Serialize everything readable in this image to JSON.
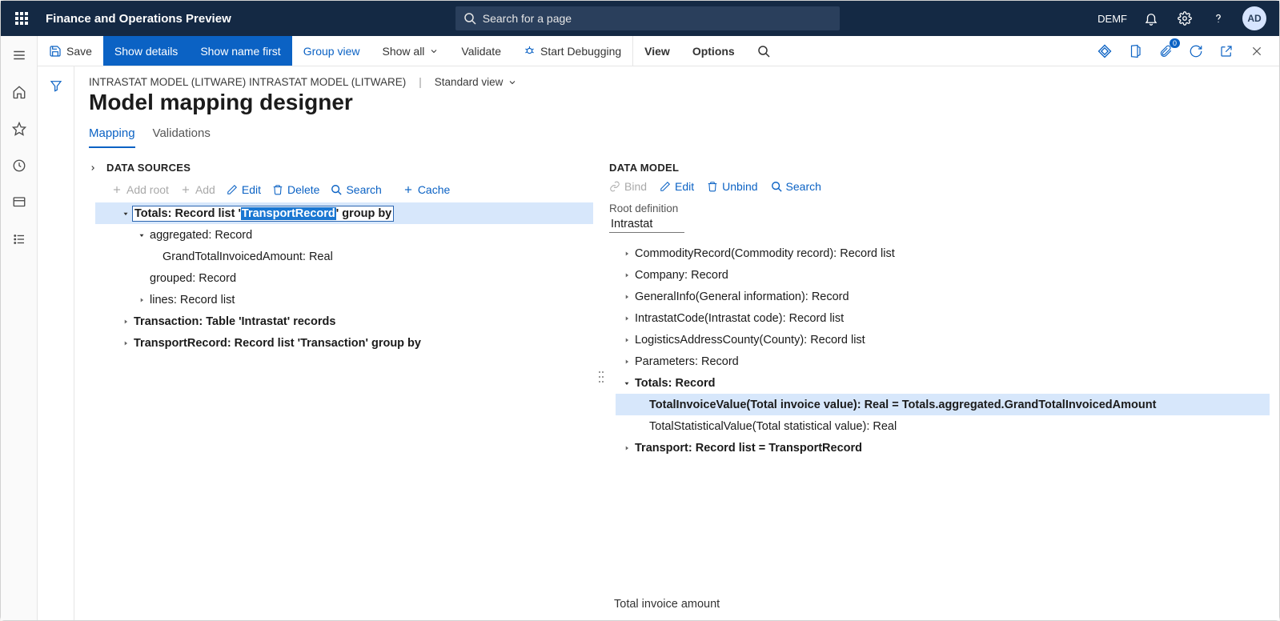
{
  "topbar": {
    "appTitle": "Finance and Operations Preview",
    "searchPlaceholder": "Search for a page",
    "companyCode": "DEMF",
    "avatarInitials": "AD"
  },
  "actionbar": {
    "save": "Save",
    "showDetails": "Show details",
    "showNameFirst": "Show name first",
    "groupView": "Group view",
    "showAll": "Show all",
    "validate": "Validate",
    "startDebugging": "Start Debugging",
    "view": "View",
    "options": "Options",
    "attachmentsCount": "0"
  },
  "breadcrumb": {
    "path": "INTRASTAT MODEL (LITWARE) INTRASTAT MODEL (LITWARE)",
    "viewName": "Standard view"
  },
  "pageTitle": "Model mapping designer",
  "tabs": {
    "mapping": "Mapping",
    "validations": "Validations"
  },
  "dataSources": {
    "heading": "DATA SOURCES",
    "toolbar": {
      "addRoot": "Add root",
      "add": "Add",
      "edit": "Edit",
      "delete": "Delete",
      "search": "Search",
      "cache": "Cache"
    },
    "tree": {
      "n0": {
        "pre": "Totals: Record list '",
        "hl": "TransportRecord",
        "post": "' group by"
      },
      "n0_0_label": "aggregated: Record",
      "n0_0_0_label": "GrandTotalInvoicedAmount: Real",
      "n0_1_label": "grouped: Record",
      "n0_2_label": "lines: Record list",
      "n1_label": "Transaction: Table 'Intrastat' records",
      "n2_label": "TransportRecord: Record list 'Transaction' group by"
    }
  },
  "dataModel": {
    "heading": "DATA MODEL",
    "toolbar": {
      "bind": "Bind",
      "edit": "Edit",
      "unbind": "Unbind",
      "search": "Search"
    },
    "rootDefLabel": "Root definition",
    "rootDefValue": "Intrastat",
    "tree": {
      "n0": "CommodityRecord(Commodity record): Record list",
      "n1": "Company: Record",
      "n2": "GeneralInfo(General information): Record",
      "n3": "IntrastatCode(Intrastat code): Record list",
      "n4": "LogisticsAddressCounty(County): Record list",
      "n5": "Parameters: Record",
      "n6": "Totals: Record",
      "n6_0": "TotalInvoiceValue(Total invoice value): Real = Totals.aggregated.GrandTotalInvoicedAmount",
      "n6_1": "TotalStatisticalValue(Total statistical value): Real",
      "n7": "Transport: Record list = TransportRecord"
    },
    "footerNote": "Total invoice amount"
  }
}
